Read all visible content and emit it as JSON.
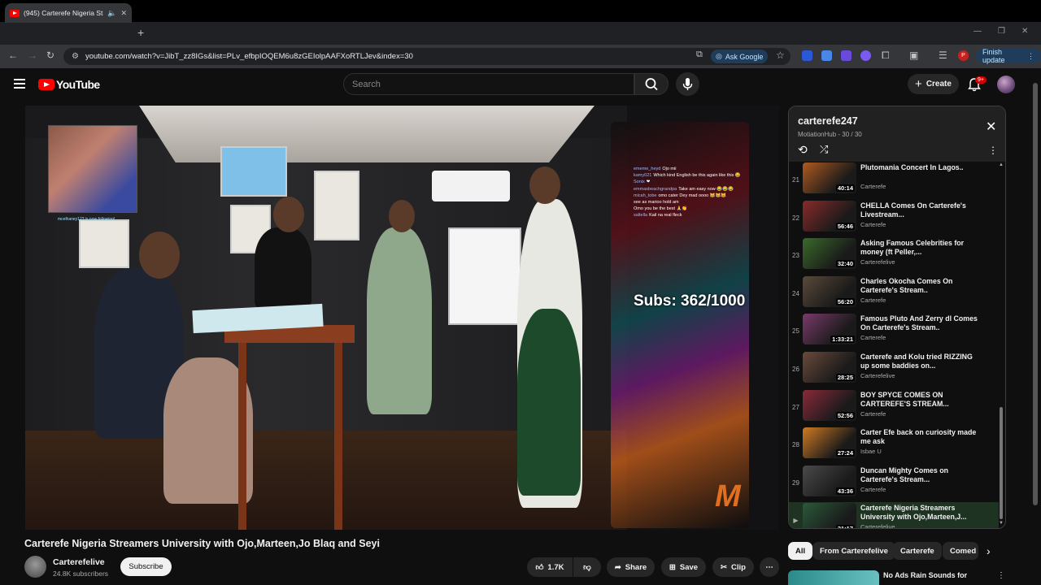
{
  "browser": {
    "tab_title": "(945) Carterefe Nigeria Stre",
    "url": "youtube.com/watch?v=JibT_zz8IGs&list=PLv_efbpIOQEM6u8zGEIolpAAFXoRTLJev&index=30",
    "ask_google": "Ask Google",
    "finish_update": "Finish update",
    "profile_initial": "P"
  },
  "header": {
    "logo": "YouTube",
    "search_placeholder": "Search",
    "create_label": "Create",
    "notifications_badge": "9+"
  },
  "video": {
    "subs_overlay": "Subs: 362/1000",
    "inset_caption": "mcelhaney123 is now following!",
    "chat": [
      {
        "user": "ememe_heyd",
        "text": "Ojo mii"
      },
      {
        "user": "kamy021",
        "text": "Which kind English be this again like this 😂"
      },
      {
        "user": "Sonix",
        "text": "❤"
      },
      {
        "user": "emmasbeachgrandpa",
        "text": "Take am easy now 😂😂😂"
      },
      {
        "user": "micah_tobe",
        "text": "omo cater Dey mad oooo 😹😹😹"
      },
      {
        "user": "",
        "text": "see as marioo hold am"
      },
      {
        "user": "",
        "text": "Omo you be the best 🙏👏"
      },
      {
        "user": "saltella",
        "text": "Kail na real fleck"
      }
    ],
    "watermark": "M"
  },
  "meta": {
    "title": "Carterefe Nigeria Streamers University with Ojo,Marteen,Jo Blaq and Seyi",
    "channel": "Carterefelive",
    "subscribers": "24.8K subscribers",
    "subscribe_label": "Subscribe",
    "likes": "1.7K",
    "share_label": "Share",
    "save_label": "Save",
    "clip_label": "Clip"
  },
  "playlist": {
    "title": "carterefe247",
    "subtitle": "MotiationHub - 30 / 30",
    "items": [
      {
        "index": "21",
        "title": "Plutomania Concert In Lagos..",
        "channel": "Carterefe",
        "duration": "40:14",
        "color": "#b05a20"
      },
      {
        "index": "22",
        "title": "CHELLA Comes On Carterefe's Livestream...",
        "channel": "Carterefe",
        "duration": "56:46",
        "color": "#8a2a2a"
      },
      {
        "index": "23",
        "title": "Asking Famous Celebrities for money (ft Peller,...",
        "channel": "Carterefelive",
        "duration": "32:40",
        "color": "#3a6a2a"
      },
      {
        "index": "24",
        "title": "Charles Okocha Comes On Carterefe's Stream..",
        "channel": "Carterefe",
        "duration": "56:20",
        "color": "#5a4a3a"
      },
      {
        "index": "25",
        "title": "Famous Pluto And Zerry dl Comes On Carterefe's Stream..",
        "channel": "Carterefe",
        "duration": "1:33:21",
        "color": "#7a3a6a"
      },
      {
        "index": "26",
        "title": "Carterefe and Kolu tried RIZZING up some baddies on...",
        "channel": "Carterefelive",
        "duration": "28:25",
        "color": "#6a4a3a"
      },
      {
        "index": "27",
        "title": "BOY SPYCE COMES ON CARTEREFE'S STREAM...",
        "channel": "Carterefe",
        "duration": "52:56",
        "color": "#8a2a3a"
      },
      {
        "index": "28",
        "title": "Carter Efe back on curiosity made me ask",
        "channel": "Isbae U",
        "duration": "27:24",
        "color": "#d07a20"
      },
      {
        "index": "29",
        "title": "Duncan Mighty Comes on Carterefe's Stream...",
        "channel": "Carterefe",
        "duration": "43:36",
        "color": "#4a4a4a"
      },
      {
        "index": "▶",
        "title": "Carterefe Nigeria Streamers University with Ojo,Marteen,J...",
        "channel": "Carterefelive",
        "duration": "31:17",
        "color": "#2a5a3a"
      }
    ]
  },
  "chips": [
    "All",
    "From Carterefelive",
    "Carterefe",
    "Comed"
  ],
  "next_video": {
    "title": "No Ads Rain Sounds for"
  }
}
